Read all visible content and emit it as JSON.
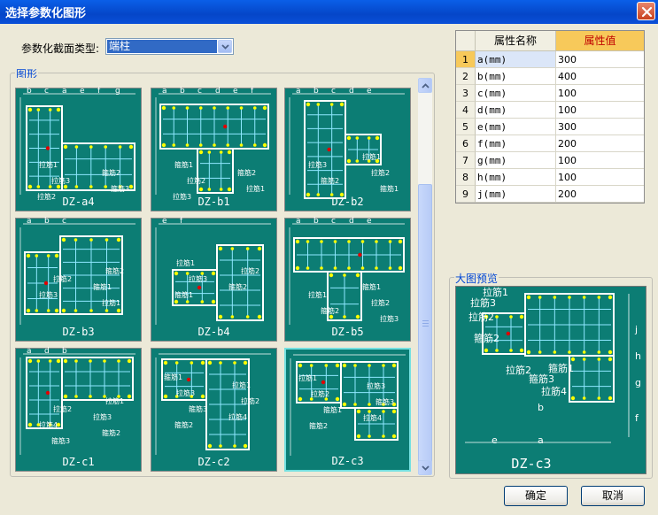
{
  "window": {
    "title": "选择参数化图形"
  },
  "section_type": {
    "label": "参数化截面类型:",
    "selected": "端柱"
  },
  "shapes_group": {
    "title": "图形"
  },
  "thumbnails": [
    {
      "label": "DZ-a4",
      "annot": [
        "b",
        "c",
        "a",
        "e",
        "f",
        "g",
        "拉筋1",
        "箍筋2",
        "拉筋3",
        "箍筋3",
        "拉筋2"
      ]
    },
    {
      "label": "DZ-b1",
      "annot": [
        "a",
        "b",
        "c",
        "d",
        "e",
        "f",
        "箍筋1",
        "箍筋2",
        "拉筋2",
        "拉筋1",
        "拉筋3"
      ]
    },
    {
      "label": "DZ-b2",
      "annot": [
        "a",
        "b",
        "c",
        "d",
        "e",
        "拉筋1",
        "拉筋3",
        "拉筋2",
        "箍筋2",
        "箍筋1"
      ]
    },
    {
      "label": "DZ-b3",
      "annot": [
        "a",
        "b",
        "c",
        "箍筋2",
        "拉筋2",
        "箍筋1",
        "拉筋3",
        "拉筋1"
      ]
    },
    {
      "label": "DZ-b4",
      "annot": [
        "e",
        "f",
        "拉筋1",
        "拉筋2",
        "拉筋3",
        "箍筋2",
        "箍筋1"
      ]
    },
    {
      "label": "DZ-b5",
      "annot": [
        "a",
        "b",
        "c",
        "d",
        "e",
        "箍筋1",
        "拉筋1",
        "拉筋2",
        "箍筋2",
        "拉筋3"
      ]
    },
    {
      "label": "DZ-c1",
      "annot": [
        "a",
        "d",
        "b",
        "拉筋1",
        "拉筋2",
        "拉筋3",
        "拉筋4",
        "箍筋2",
        "箍筋3"
      ]
    },
    {
      "label": "DZ-c2",
      "annot": [
        "箍筋1",
        "拉筋1",
        "拉筋3",
        "拉筋2",
        "箍筋3",
        "拉筋4",
        "箍筋2"
      ]
    },
    {
      "label": "DZ-c3",
      "annot": [
        "拉筋1",
        "拉筋3",
        "拉筋2",
        "箍筋3",
        "箍筋1",
        "拉筋4",
        "箍筋2"
      ]
    }
  ],
  "properties": {
    "headers": [
      "属性名称",
      "属性值"
    ],
    "rows": [
      {
        "idx": "1",
        "name": "a(mm)",
        "value": "300"
      },
      {
        "idx": "2",
        "name": "b(mm)",
        "value": "400"
      },
      {
        "idx": "3",
        "name": "c(mm)",
        "value": "100"
      },
      {
        "idx": "4",
        "name": "d(mm)",
        "value": "100"
      },
      {
        "idx": "5",
        "name": "e(mm)",
        "value": "300"
      },
      {
        "idx": "6",
        "name": "f(mm)",
        "value": "200"
      },
      {
        "idx": "7",
        "name": "g(mm)",
        "value": "100"
      },
      {
        "idx": "8",
        "name": "h(mm)",
        "value": "100"
      },
      {
        "idx": "9",
        "name": "j(mm)",
        "value": "200"
      }
    ]
  },
  "preview": {
    "title": "大图预览",
    "label": "DZ-c3",
    "annot": [
      "拉筋1",
      "拉筋3",
      "拉筋2",
      "箍筋2",
      "拉筋2",
      "箍筋1",
      "箍筋3",
      "拉筋4",
      "b",
      "a",
      "e",
      "f",
      "g",
      "h",
      "j"
    ]
  },
  "buttons": {
    "ok": "确定",
    "cancel": "取消"
  },
  "colors": {
    "canvas": "#0c7d74",
    "rebar": "#ffffff",
    "tie": "#8ee8ff",
    "corner_dot": "#ffff00",
    "center_dot": "#e00000"
  }
}
